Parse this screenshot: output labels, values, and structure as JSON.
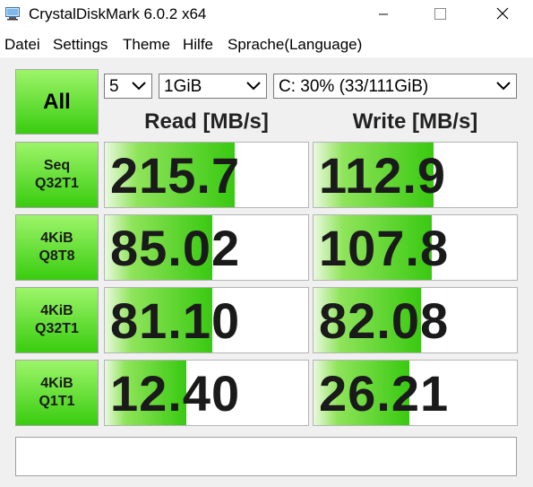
{
  "window": {
    "title": "CrystalDiskMark 6.0.2 x64",
    "icon": "crystaldiskmark-app-icon"
  },
  "menu": [
    "Datei",
    "Settings",
    "Theme",
    "Hilfe",
    "Sprache(Language)"
  ],
  "controls": {
    "all_label": "All",
    "count_value": "5",
    "size_value": "1GiB",
    "drive_value": "C: 30% (33/111GiB)"
  },
  "headers": {
    "read": "Read [MB/s]",
    "write": "Write [MB/s]"
  },
  "tests": [
    {
      "line1": "Seq",
      "line2": "Q32T1",
      "read": "215.7",
      "write": "112.9",
      "read_level": 0.64,
      "write_level": 0.59
    },
    {
      "line1": "4KiB",
      "line2": "Q8T8",
      "read": "85.02",
      "write": "107.8",
      "read_level": 0.53,
      "write_level": 0.58
    },
    {
      "line1": "4KiB",
      "line2": "Q32T1",
      "read": "81.10",
      "write": "82.08",
      "read_level": 0.53,
      "write_level": 0.53
    },
    {
      "line1": "4KiB",
      "line2": "Q1T1",
      "read": "12.40",
      "write": "26.21",
      "read_level": 0.4,
      "write_level": 0.47
    }
  ],
  "comment": "",
  "colors": {
    "accent_green": "#39cc0f",
    "light_green": "#9df56a"
  }
}
